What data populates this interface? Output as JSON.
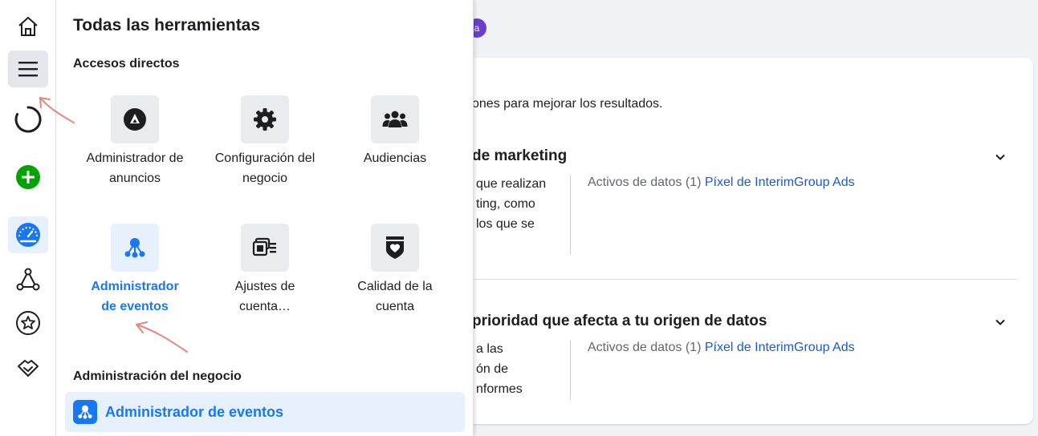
{
  "colors": {
    "accent": "#1877f2",
    "link": "#1a5bc9",
    "create_green": "#00a400",
    "annotation": "#e8857a"
  },
  "rail": {
    "items": [
      {
        "name": "home-icon"
      },
      {
        "name": "menu-icon"
      },
      {
        "name": "loading-icon"
      },
      {
        "name": "create-icon"
      },
      {
        "name": "dashboard-icon"
      },
      {
        "name": "network-icon"
      },
      {
        "name": "star-icon"
      },
      {
        "name": "handshake-icon"
      }
    ]
  },
  "panel": {
    "title": "Todas las herramientas",
    "shortcuts_label": "Accesos directos",
    "tiles": [
      {
        "label": "Administrador de anuncios",
        "icon": "ads-manager-icon"
      },
      {
        "label": "Configuración del negocio",
        "icon": "gear-icon"
      },
      {
        "label": "Audiencias",
        "icon": "people-icon"
      },
      {
        "label": "Administrador de eventos",
        "icon": "events-manager-icon"
      },
      {
        "label": "Ajustes de cuenta…",
        "icon": "account-settings-icon"
      },
      {
        "label": "Calidad de la cuenta",
        "icon": "shield-heart-icon"
      }
    ],
    "business_label": "Administración del negocio",
    "business_item": {
      "label": "Administrador de eventos",
      "icon": "events-manager-icon"
    }
  },
  "background": {
    "chip_text": "a",
    "subtitle": "ones para mejorar los resultados.",
    "sections": [
      {
        "title": "de marketing",
        "desc": [
          "que realizan",
          "ting, como",
          "los que se"
        ],
        "assets_label": "Activos de datos (1)",
        "assets_link": "Píxel de InterimGroup Ads"
      },
      {
        "title": "prioridad que afecta a tu origen de datos",
        "desc": [
          "a las",
          "ón de",
          "nformes"
        ],
        "assets_label": "Activos de datos (1)",
        "assets_link": "Píxel de InterimGroup Ads"
      }
    ]
  }
}
